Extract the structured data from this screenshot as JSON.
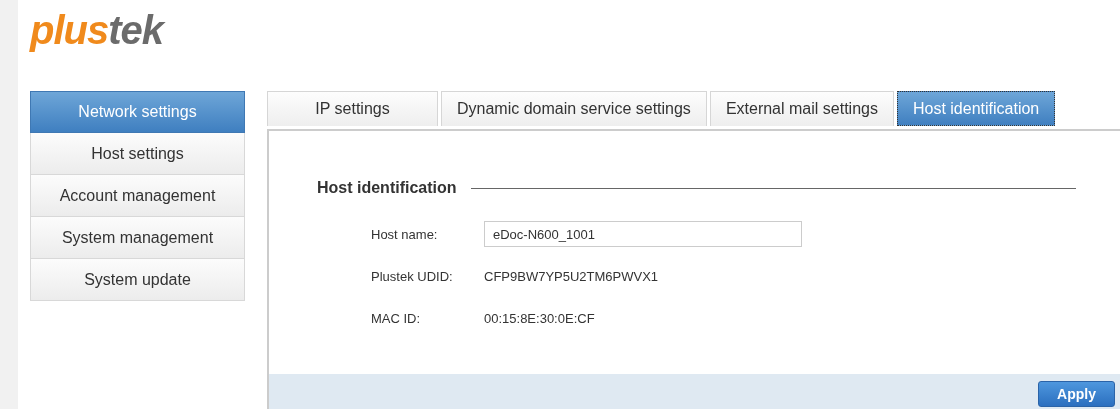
{
  "logo": {
    "parts": [
      {
        "text": "plus",
        "kind": "accent"
      },
      {
        "text": "tek",
        "kind": "base"
      }
    ]
  },
  "sidebar": {
    "items": [
      {
        "label": "Network settings",
        "selected": true
      },
      {
        "label": "Host settings",
        "selected": false
      },
      {
        "label": "Account management",
        "selected": false
      },
      {
        "label": "System management",
        "selected": false
      },
      {
        "label": "System update",
        "selected": false
      }
    ]
  },
  "tabs": [
    {
      "label": "IP settings",
      "selected": false
    },
    {
      "label": "Dynamic domain service settings",
      "selected": false
    },
    {
      "label": "External mail settings",
      "selected": false
    },
    {
      "label": "Host identification",
      "selected": true
    }
  ],
  "section": {
    "title": "Host identification",
    "fields": [
      {
        "label": "Host name:",
        "kind": "input",
        "value": "eDoc-N600_1001"
      },
      {
        "label": "Plustek UDID:",
        "kind": "text",
        "value": "CFP9BW7YP5U2TM6PWVX1"
      },
      {
        "label": "MAC ID:",
        "kind": "text",
        "value": "00:15:8E:30:0E:CF"
      }
    ]
  },
  "footer": {
    "buttons": [
      "Apply"
    ]
  }
}
